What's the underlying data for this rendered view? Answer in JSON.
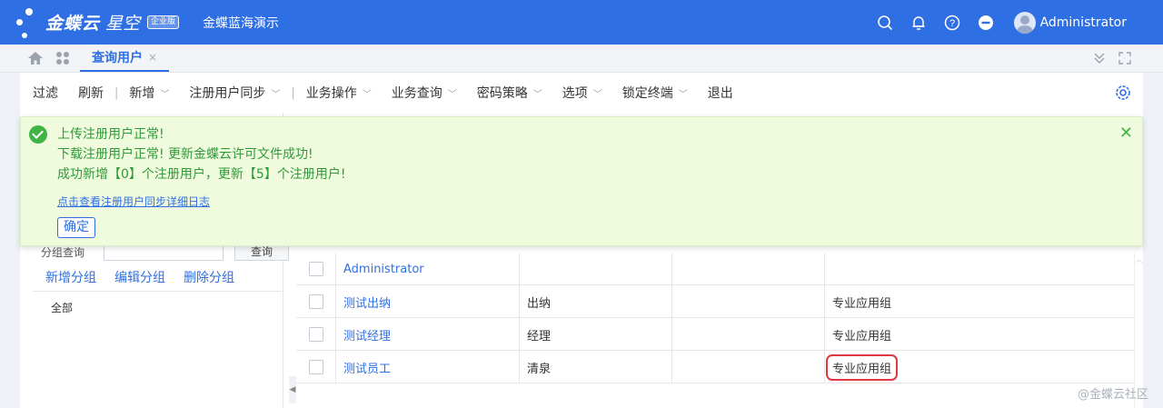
{
  "header": {
    "brand_main": "金蝶云",
    "brand_sub": "星空",
    "edition": "企业版",
    "org_name": "金蝶蓝海演示",
    "user_name": "Administrator",
    "icons": [
      "search-icon",
      "bell-icon",
      "help-icon",
      "minus-circle-icon"
    ]
  },
  "tabs": {
    "active_label": "查询用户",
    "close_glyph": "×"
  },
  "toolbar": {
    "filter": "过滤",
    "refresh": "刷新",
    "add": "新增",
    "register_sync": "注册用户同步",
    "business_ops": "业务操作",
    "business_query": "业务查询",
    "password_policy": "密码策略",
    "options": "选项",
    "lock_terminal": "锁定终端",
    "exit": "退出",
    "separator": "|"
  },
  "message": {
    "line1": "上传注册用户正常!",
    "line2": "下载注册用户正常! 更新金蝶云许可文件成功!",
    "line3": "成功新增【0】个注册用户，更新【5】个注册用户!",
    "link": "点击查看注册用户同步详细日志",
    "ok_button": "确定",
    "close_glyph": "✕"
  },
  "left_panel": {
    "search_label": "分组查询",
    "search_button": "查询",
    "add_group": "新增分组",
    "edit_group": "编辑分组",
    "delete_group": "删除分组",
    "groups": [
      "全部"
    ]
  },
  "grid": {
    "rows": [
      {
        "name": "Administrator",
        "col2": "",
        "col3": "",
        "col4": ""
      },
      {
        "name": "测试出纳",
        "col2": "出纳",
        "col3": "",
        "col4": "专业应用组"
      },
      {
        "name": "测试经理",
        "col2": "经理",
        "col3": "",
        "col4": "专业应用组"
      },
      {
        "name": "测试员工",
        "col2": "清泉",
        "col3": "",
        "col4": "专业应用组"
      }
    ]
  },
  "watermark": "@金蝶云社区",
  "colors": {
    "primary": "#2f6fe4",
    "success": "#3fb445",
    "success_bg": "#f0fbde",
    "highlight": "#e0383e"
  }
}
